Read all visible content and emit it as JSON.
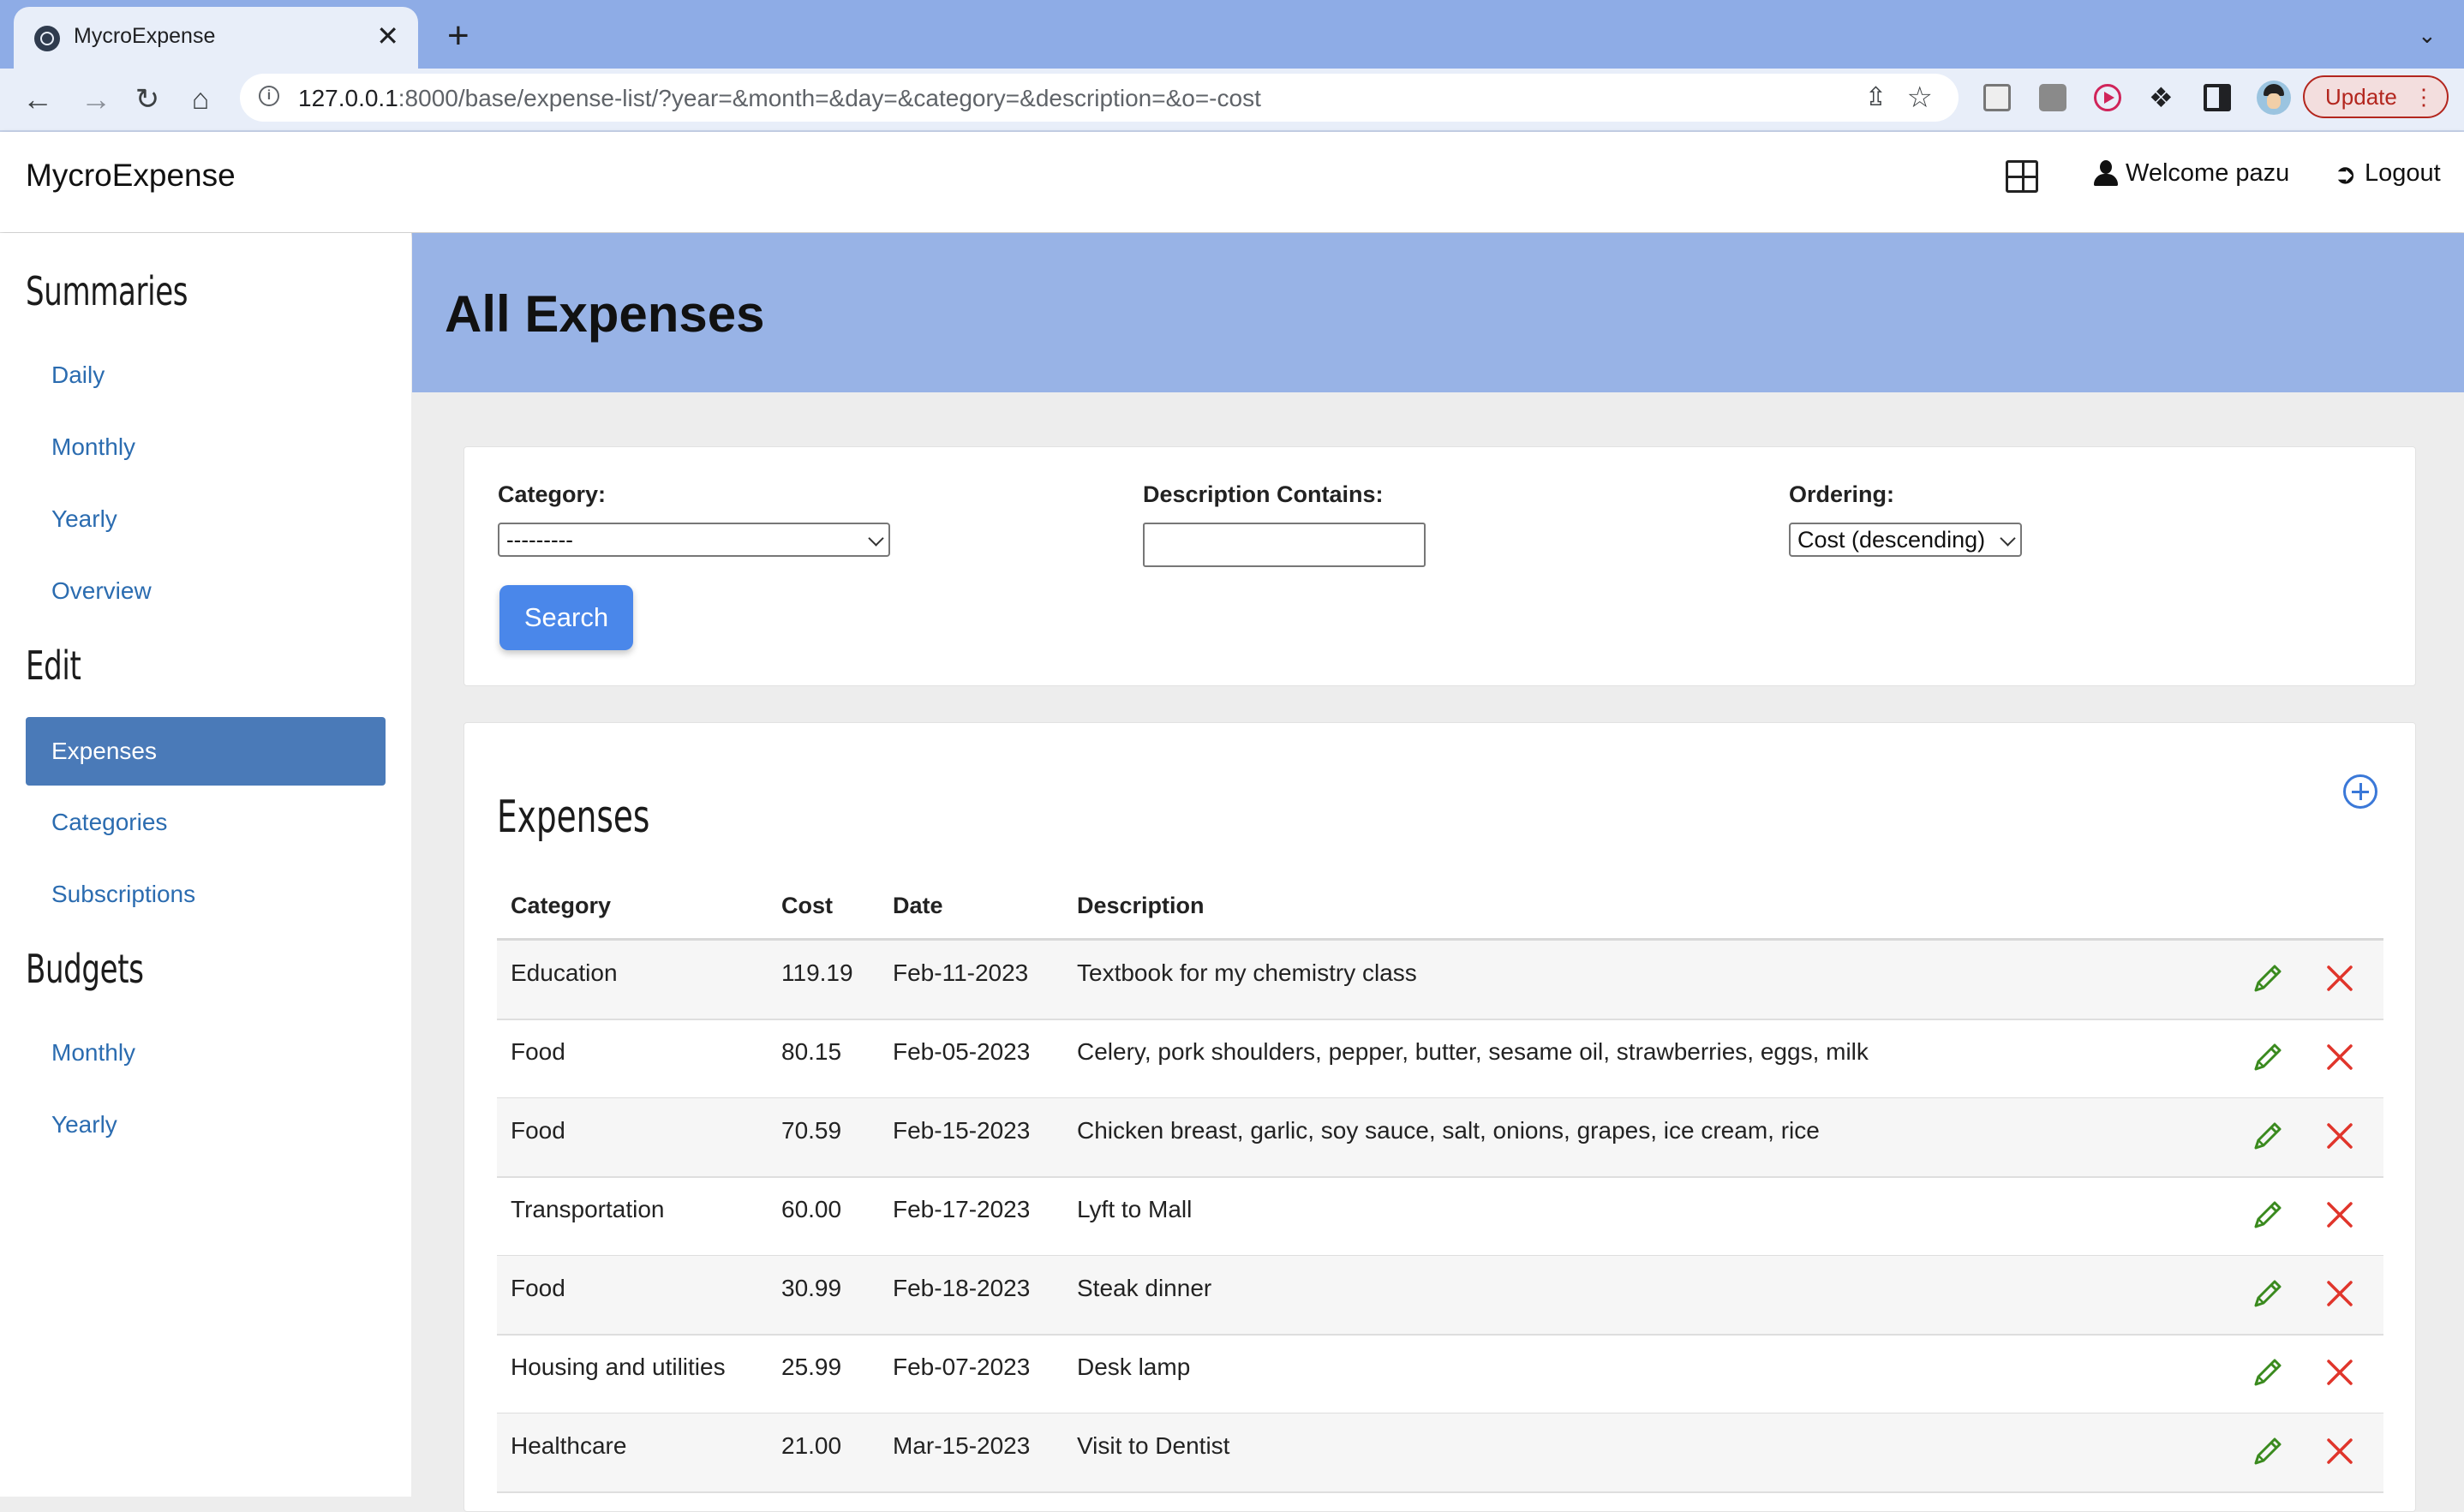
{
  "browser": {
    "tab_title": "MycroExpense",
    "tab_close": "✕",
    "new_tab": "+",
    "url_host": "127.0.0.1",
    "url_rest": ":8000/base/expense-list/?year=&month=&day=&category=&description=&o=-cost",
    "update_label": "Update"
  },
  "header": {
    "brand": "MycroExpense",
    "welcome": "Welcome pazu",
    "logout": "Logout"
  },
  "sidebar": {
    "summaries_heading": "Summaries",
    "summaries": [
      "Daily",
      "Monthly",
      "Yearly",
      "Overview"
    ],
    "edit_heading": "Edit",
    "edit": [
      "Expenses",
      "Categories",
      "Subscriptions"
    ],
    "active": "Expenses",
    "budgets_heading": "Budgets",
    "budgets": [
      "Monthly",
      "Yearly"
    ]
  },
  "page": {
    "title": "All Expenses"
  },
  "filters": {
    "category_label": "Category:",
    "category_value": "---------",
    "description_label": "Description Contains:",
    "description_value": "",
    "ordering_label": "Ordering:",
    "ordering_value": "Cost (descending)",
    "search_label": "Search"
  },
  "expenses": {
    "heading": "Expenses",
    "columns": [
      "Category",
      "Cost",
      "Date",
      "Description"
    ],
    "rows": [
      {
        "category": "Education",
        "cost": "119.19",
        "date": "Feb-11-2023",
        "description": "Textbook for my chemistry class"
      },
      {
        "category": "Food",
        "cost": "80.15",
        "date": "Feb-05-2023",
        "description": "Celery, pork shoulders, pepper, butter, sesame oil, strawberries, eggs, milk"
      },
      {
        "category": "Food",
        "cost": "70.59",
        "date": "Feb-15-2023",
        "description": "Chicken breast, garlic, soy sauce, salt, onions, grapes, ice cream, rice"
      },
      {
        "category": "Transportation",
        "cost": "60.00",
        "date": "Feb-17-2023",
        "description": "Lyft to Mall"
      },
      {
        "category": "Food",
        "cost": "30.99",
        "date": "Feb-18-2023",
        "description": "Steak dinner"
      },
      {
        "category": "Housing and utilities",
        "cost": "25.99",
        "date": "Feb-07-2023",
        "description": "Desk lamp"
      },
      {
        "category": "Healthcare",
        "cost": "21.00",
        "date": "Mar-15-2023",
        "description": "Visit to Dentist"
      }
    ]
  },
  "colors": {
    "accent": "#4a87ea",
    "banner": "#98b3e6",
    "sidebar_active": "#4a7ab8",
    "edit_icon": "#3a8a1e",
    "delete_icon": "#e0352b",
    "link": "#2b6cb0"
  }
}
